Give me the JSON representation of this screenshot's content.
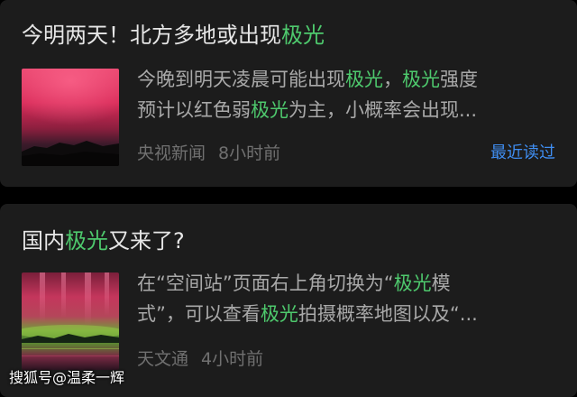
{
  "feed": {
    "items": [
      {
        "title_parts": [
          "今明两天！北方多地或出现",
          "极光",
          ""
        ],
        "summary_line1_parts": [
          "今晚到明天凌晨可能出现",
          "极光",
          "，",
          "极光",
          "强度"
        ],
        "summary_line2_parts": [
          "预计以红色弱",
          "极光",
          "为主，小概率会出现..."
        ],
        "source": "央视新闻",
        "time": "8小时前",
        "badge": "最近读过",
        "thumbnail": "red-aurora-over-hills-image"
      },
      {
        "title_parts": [
          "国内",
          "极光",
          "又来了?"
        ],
        "summary_line1_parts": [
          "在“空间站”页面右上角切换为“",
          "极光",
          "模"
        ],
        "summary_line2_parts": [
          "式”，可以查看",
          "极光",
          "拍摄概率地图以及“..."
        ],
        "source": "天文通",
        "time": "4小时前",
        "thumbnail": "red-green-aurora-over-lake-image"
      }
    ]
  },
  "watermark": "搜狐号@温柔一辉",
  "colors": {
    "background": "#000000",
    "card": "#1c1c1c",
    "title": "#e6e6e6",
    "highlight": "#4ec96d",
    "summary": "#a9a9a9",
    "meta": "#707070",
    "badge": "#3f8ef2"
  }
}
